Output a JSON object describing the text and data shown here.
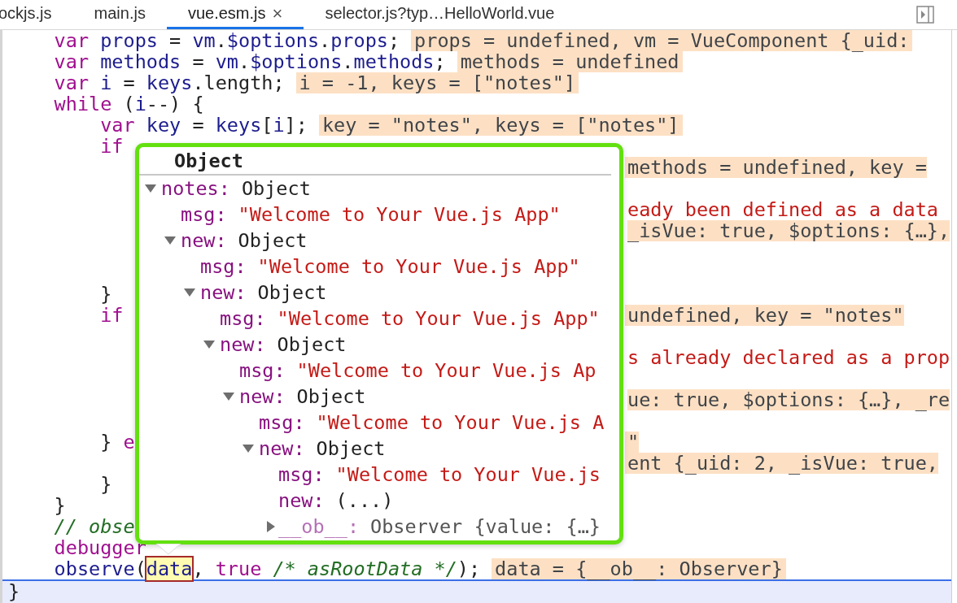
{
  "tabs": [
    {
      "label": "ockjs.js",
      "selected": false
    },
    {
      "label": "main.js",
      "selected": false
    },
    {
      "label": "vue.esm.js",
      "selected": true,
      "close_glyph": "×"
    },
    {
      "label": "selector.js?typ…HelloWorld.vue",
      "selected": false
    }
  ],
  "code_lines": [
    {
      "current": false,
      "code": [
        {
          "text": "    var",
          "kind": "keyword"
        },
        {
          "text": " props",
          "kind": "identifier"
        },
        {
          "text": " = ",
          "kind": "plain"
        },
        {
          "text": "vm",
          "kind": "identifier"
        },
        {
          "text": ".",
          "kind": "plain"
        },
        {
          "text": "$options",
          "kind": "identifier"
        },
        {
          "text": ".",
          "kind": "plain"
        },
        {
          "text": "props",
          "kind": "identifier"
        },
        {
          "text": ";",
          "kind": "plain"
        }
      ],
      "inline_value": "props = undefined, vm = VueComponent {_uid:"
    },
    {
      "current": false,
      "code": [
        {
          "text": "    var",
          "kind": "keyword"
        },
        {
          "text": " methods",
          "kind": "identifier"
        },
        {
          "text": " = ",
          "kind": "plain"
        },
        {
          "text": "vm",
          "kind": "identifier"
        },
        {
          "text": ".",
          "kind": "plain"
        },
        {
          "text": "$options",
          "kind": "identifier"
        },
        {
          "text": ".",
          "kind": "plain"
        },
        {
          "text": "methods",
          "kind": "identifier"
        },
        {
          "text": ";",
          "kind": "plain"
        }
      ],
      "inline_value": "methods = undefined"
    },
    {
      "current": false,
      "code": [
        {
          "text": "    var",
          "kind": "keyword"
        },
        {
          "text": " i",
          "kind": "identifier"
        },
        {
          "text": " = ",
          "kind": "plain"
        },
        {
          "text": "keys",
          "kind": "identifier"
        },
        {
          "text": ".length;",
          "kind": "plain"
        }
      ],
      "inline_value": "i = -1, keys = [\"notes\"]"
    },
    {
      "current": false,
      "code": [
        {
          "text": "    while",
          "kind": "keyword"
        },
        {
          "text": " (",
          "kind": "plain"
        },
        {
          "text": "i",
          "kind": "identifier"
        },
        {
          "text": "--) {",
          "kind": "plain"
        }
      ]
    },
    {
      "current": false,
      "code": [
        {
          "text": "        var",
          "kind": "keyword"
        },
        {
          "text": " key",
          "kind": "identifier"
        },
        {
          "text": " = ",
          "kind": "plain"
        },
        {
          "text": "keys",
          "kind": "identifier"
        },
        {
          "text": "[",
          "kind": "plain"
        },
        {
          "text": "i",
          "kind": "identifier"
        },
        {
          "text": "];",
          "kind": "plain"
        }
      ],
      "inline_value": "key = \"notes\", keys = [\"notes\"]"
    },
    {
      "current": false,
      "code": [
        {
          "text": "        if",
          "kind": "keyword"
        }
      ]
    },
    {
      "fragment": {
        "text": "methods = undefined, key =",
        "kind": "value"
      }
    },
    {
      "blank_before": true,
      "fragment": {
        "text": "eady been defined as a data",
        "kind": "string"
      }
    },
    {
      "blank_after": true,
      "fragment": {
        "text": "_isVue: true, $options: {…},",
        "kind": "value"
      }
    },
    {
      "blank_before": true,
      "current": false,
      "code": [
        {
          "text": "        }",
          "kind": "plain"
        }
      ]
    },
    {
      "current": false,
      "code": [
        {
          "text": "        if",
          "kind": "keyword"
        }
      ],
      "fragment": {
        "text": "undefined, key = \"notes\"",
        "kind": "value"
      }
    },
    {
      "blank_before": true,
      "fragment": {
        "text": "s already declared as a prop",
        "kind": "string"
      }
    },
    {
      "blank_before": true,
      "fragment": {
        "text": "ue: true, $options: {…}, _re",
        "kind": "value"
      }
    },
    {
      "blank_before": true,
      "current": false,
      "code": [
        {
          "text": "        }",
          "kind": "plain"
        },
        {
          "text": " e",
          "kind": "keyword"
        }
      ],
      "fragment": {
        "text": "\"",
        "kind": "value"
      }
    },
    {
      "fragment": {
        "text": "ent {_uid: 2, _isVue: true,",
        "kind": "value"
      }
    },
    {
      "current": false,
      "code": [
        {
          "text": "        }",
          "kind": "plain"
        }
      ]
    },
    {
      "current": false,
      "code": [
        {
          "text": "    }",
          "kind": "plain"
        }
      ]
    },
    {
      "current": false,
      "code": [
        {
          "text": "    // obse",
          "kind": "comment"
        }
      ]
    },
    {
      "current": false,
      "code": [
        {
          "text": "    debugger",
          "kind": "keyword"
        }
      ]
    },
    {
      "current": false,
      "code": [
        {
          "text": "    observe",
          "kind": "identifier"
        },
        {
          "text": "(",
          "kind": "plain"
        },
        {
          "text": "data",
          "kind": "highlight"
        },
        {
          "text": ", ",
          "kind": "plain"
        },
        {
          "text": "true",
          "kind": "keyword"
        },
        {
          "text": " /* asRootData */",
          "kind": "comment"
        },
        {
          "text": ");",
          "kind": "plain"
        }
      ],
      "inline_value": "data = {__ob__: Observer}"
    },
    {
      "current": true,
      "code": [
        {
          "text": "}",
          "kind": "plain"
        }
      ]
    }
  ],
  "popup": {
    "title": "Object",
    "tree": [
      {
        "key": "notes:",
        "value": "Object",
        "kind": "object",
        "expanded": true,
        "children": [
          {
            "key": "msg:",
            "value": "\"Welcome to Your Vue.js App\"",
            "kind": "string"
          },
          {
            "key": "new:",
            "value": "Object",
            "kind": "object",
            "expanded": true,
            "children": [
              {
                "key": "msg:",
                "value": "\"Welcome to Your Vue.js App\"",
                "kind": "string"
              },
              {
                "key": "new:",
                "value": "Object",
                "kind": "object",
                "expanded": true,
                "children": [
                  {
                    "key": "msg:",
                    "value": "\"Welcome to Your Vue.js App\"",
                    "kind": "string"
                  },
                  {
                    "key": "new:",
                    "value": "Object",
                    "kind": "object",
                    "expanded": true,
                    "children": [
                      {
                        "key": "msg:",
                        "value": "\"Welcome to Your Vue.js Ap",
                        "kind": "string"
                      },
                      {
                        "key": "new:",
                        "value": "Object",
                        "kind": "object",
                        "expanded": true,
                        "children": [
                          {
                            "key": "msg:",
                            "value": "\"Welcome to Your Vue.js A",
                            "kind": "string"
                          },
                          {
                            "key": "new:",
                            "value": "Object",
                            "kind": "object",
                            "expanded": true,
                            "children": [
                              {
                                "key": "msg:",
                                "value": "\"Welcome to Your Vue.js",
                                "kind": "string"
                              },
                              {
                                "key": "new:",
                                "value": "(...)",
                                "kind": "getter"
                              },
                              {
                                "key": "__ob__:",
                                "value": "Observer {value: {…}",
                                "kind": "internal",
                                "expanded": false
                              }
                            ]
                          }
                        ]
                      }
                    ]
                  }
                ]
              }
            ]
          }
        ]
      }
    ]
  }
}
